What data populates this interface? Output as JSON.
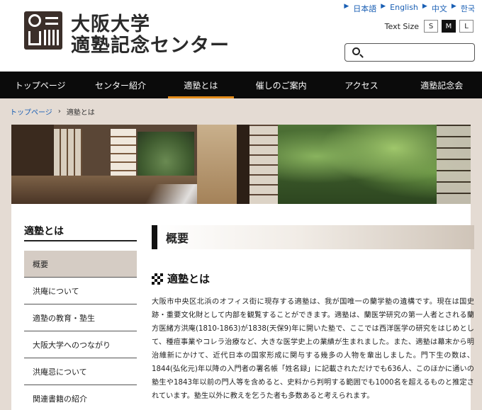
{
  "header": {
    "logo_line1": "大阪大学",
    "logo_line2": "適塾記念センター",
    "languages": [
      "日本語",
      "English",
      "中文",
      "한국"
    ],
    "text_size_label": "Text Size",
    "text_sizes": [
      "S",
      "M",
      "L"
    ],
    "active_text_size": "M",
    "search_placeholder": ""
  },
  "nav": {
    "items": [
      "トップページ",
      "センター紹介",
      "適塾とは",
      "催しのご案内",
      "アクセス",
      "適塾記念会"
    ],
    "active": "適塾とは"
  },
  "breadcrumb": {
    "home": "トップページ",
    "separator": "›",
    "current": "適塾とは"
  },
  "sidebar": {
    "title": "適塾とは",
    "items": [
      "概要",
      "洪庵について",
      "適塾の教育・塾生",
      "大阪大学へのつながり",
      "洪庵忌について",
      "関連書籍の紹介"
    ],
    "active": "概要"
  },
  "main": {
    "heading": "概要",
    "subheading": "適塾とは",
    "paragraph": "大阪市中央区北浜のオフィス街に現存する適塾は、我が国唯一の蘭学塾の遺構です。現在は国史跡・重要文化財として内部を観覧することができます。適塾は、蘭医学研究の第一人者とされる蘭方医緒方洪庵(1810-1863)が1838(天保9)年に開いた塾で、ここでは西洋医学の研究をはじめとして、種痘事業やコレラ治療など、大きな医学史上の業績が生まれました。また、適塾は幕末から明治維新にかけて、近代日本の国家形成に関与する幾多の人物を輩出しました。門下生の数は、1844(弘化元)年以降の入門者の署名帳「姓名録」に記載されただけでも636人、このほかに通いの塾生や1843年以前の門人等を含めると、史料から判明する範囲でも1000名を超えるものと推定されています。塾生以外に教えを乞うた者も多数あると考えられます。"
  },
  "colors": {
    "nav_bg": "#0b0b0b",
    "nav_active_underline": "#e38b1a",
    "band_bg": "#e4dbd3",
    "link": "#1a5fb4"
  }
}
